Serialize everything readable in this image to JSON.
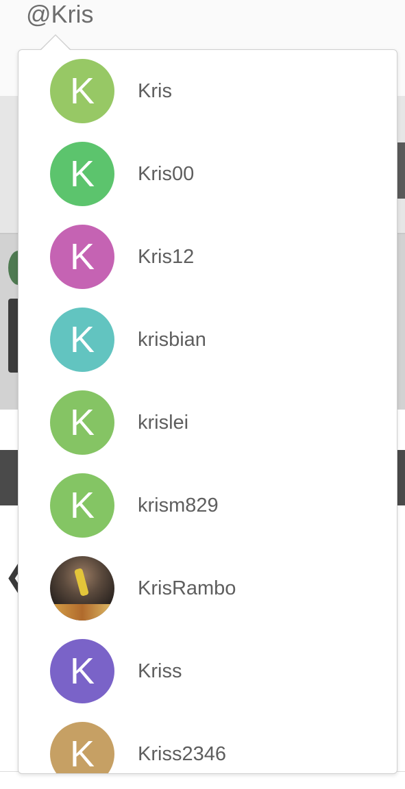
{
  "query_text": "@Kris",
  "users": [
    {
      "name": "Kris",
      "initial": "K",
      "color": "#97c865",
      "avatar": "letter"
    },
    {
      "name": "Kris00",
      "initial": "K",
      "color": "#5cc46d",
      "avatar": "letter"
    },
    {
      "name": "Kris12",
      "initial": "K",
      "color": "#c563b3",
      "avatar": "letter"
    },
    {
      "name": "krisbian",
      "initial": "K",
      "color": "#62c4c0",
      "avatar": "letter"
    },
    {
      "name": "krislei",
      "initial": "K",
      "color": "#85c464",
      "avatar": "letter"
    },
    {
      "name": "krism829",
      "initial": "K",
      "color": "#84c564",
      "avatar": "letter"
    },
    {
      "name": "KrisRambo",
      "initial": "",
      "color": "#3a3230",
      "avatar": "photo"
    },
    {
      "name": "Kriss",
      "initial": "K",
      "color": "#7a63c8",
      "avatar": "letter"
    },
    {
      "name": "Kriss2346",
      "initial": "K",
      "color": "#c6a064",
      "avatar": "letter"
    }
  ]
}
